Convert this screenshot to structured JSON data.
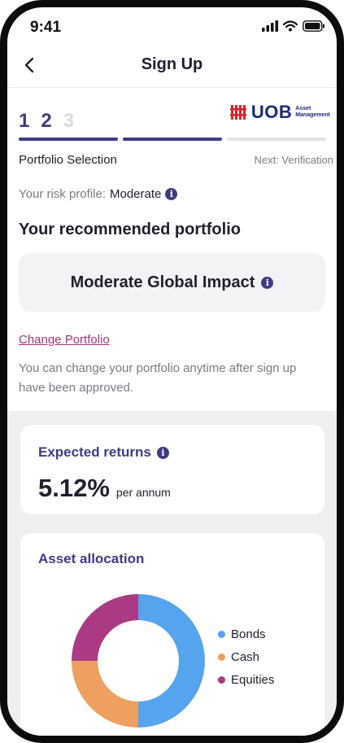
{
  "status_bar": {
    "time": "9:41"
  },
  "header": {
    "title": "Sign Up",
    "back_icon": "chevron-left-icon"
  },
  "stepper": {
    "steps": [
      "1",
      "2",
      "3"
    ],
    "current_step": 2,
    "current_label": "Portfolio Selection",
    "next_label": "Next: Verification"
  },
  "brand": {
    "name": "UOB",
    "sub_line1": "Asset",
    "sub_line2": "Management",
    "color": "#1b2a7c",
    "mark_color": "#d6232c"
  },
  "risk": {
    "label": "Your risk profile:",
    "value": "Moderate"
  },
  "recommended": {
    "title": "Your recommended portfolio",
    "portfolio_name": "Moderate Global Impact",
    "change_link": "Change Portfolio",
    "note": "You can change your portfolio anytime after sign up have been approved."
  },
  "returns": {
    "title": "Expected returns",
    "value": "5.12%",
    "unit": "per annum"
  },
  "allocation": {
    "title": "Asset allocation"
  },
  "chart_data": {
    "type": "pie",
    "categories": [
      "Bonds",
      "Cash",
      "Equities"
    ],
    "values": [
      50,
      25,
      25
    ],
    "colors": [
      "#56a3ee",
      "#eda05f",
      "#ab3a84"
    ],
    "legend": "right"
  },
  "colors": {
    "accent": "#3f3c83",
    "link": "#a3347b"
  }
}
